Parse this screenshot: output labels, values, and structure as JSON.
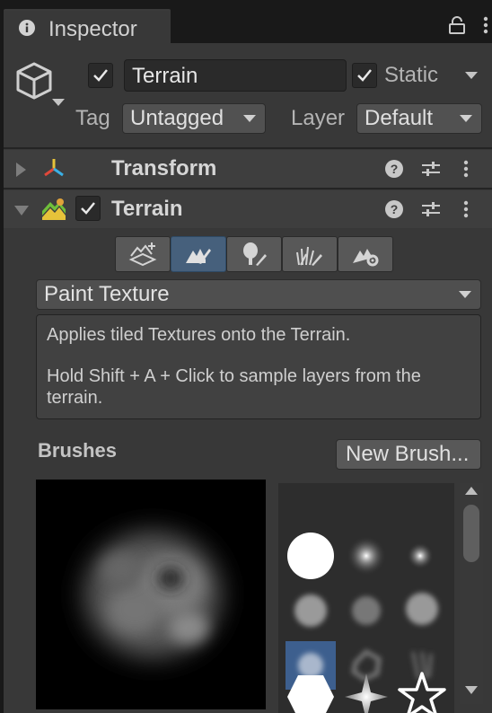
{
  "tab": {
    "title": "Inspector",
    "icon": "info-icon"
  },
  "header": {
    "object_icon": "cube-icon",
    "active_checked": true,
    "name": "Terrain",
    "static_checked": true,
    "static_label": "Static",
    "tag_label": "Tag",
    "tag_value": "Untagged",
    "layer_label": "Layer",
    "layer_value": "Default"
  },
  "components": [
    {
      "title": "Transform",
      "expanded": false,
      "icon": "transform-axes-icon"
    },
    {
      "title": "Terrain",
      "expanded": true,
      "enabled": true,
      "icon": "terrain-icon"
    }
  ],
  "terrain_tools": {
    "buttons": [
      {
        "name": "create-neighbor-terrains",
        "icon": "terrain-add-icon",
        "active": false
      },
      {
        "name": "paint-terrain",
        "icon": "paint-terrain-icon",
        "active": true
      },
      {
        "name": "paint-trees",
        "icon": "paint-trees-icon",
        "active": false
      },
      {
        "name": "paint-details",
        "icon": "paint-details-icon",
        "active": false
      },
      {
        "name": "terrain-settings",
        "icon": "terrain-settings-icon",
        "active": false
      }
    ],
    "mode": "Paint Texture",
    "help_line1": "Applies tiled Textures onto the Terrain.",
    "help_line2": "Hold Shift + A + Click to sample layers from the",
    "help_line3": "terrain."
  },
  "brushes": {
    "label": "Brushes",
    "new_brush_label": "New Brush...",
    "selected_index": 6,
    "grid": [
      "hard-circle",
      "soft-circle",
      "small-soft-circle",
      "cloud",
      "noise-cloud",
      "blotch",
      "splatter",
      "hex-cells",
      "streaks",
      "hexagon",
      "four-point-star",
      "star-outline"
    ]
  },
  "colors": {
    "accent": "#46607c",
    "selected_brush": "#3d5f8e",
    "panel": "#383838"
  }
}
